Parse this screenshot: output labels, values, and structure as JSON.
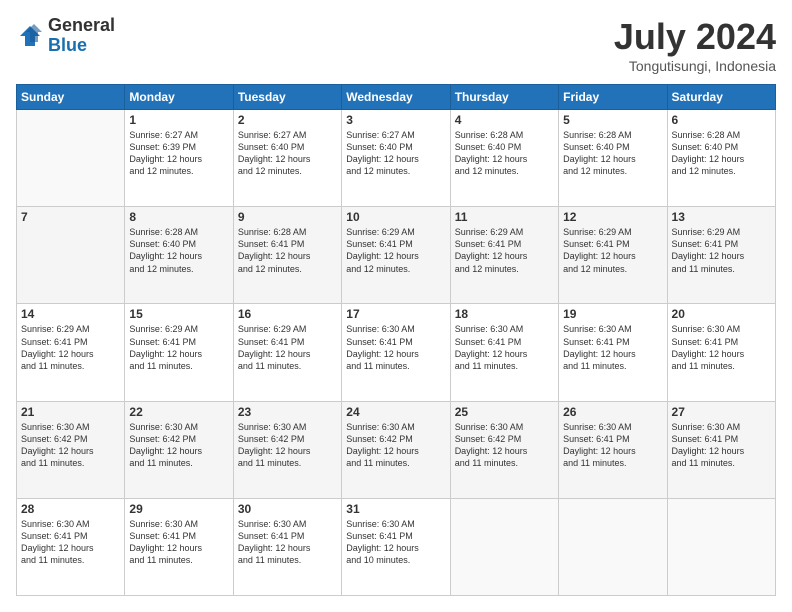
{
  "header": {
    "logo_line1": "General",
    "logo_line2": "Blue",
    "month_title": "July 2024",
    "location": "Tongutisungi, Indonesia"
  },
  "weekdays": [
    "Sunday",
    "Monday",
    "Tuesday",
    "Wednesday",
    "Thursday",
    "Friday",
    "Saturday"
  ],
  "weeks": [
    [
      {
        "day": "",
        "info": ""
      },
      {
        "day": "1",
        "info": "Sunrise: 6:27 AM\nSunset: 6:39 PM\nDaylight: 12 hours\nand 12 minutes."
      },
      {
        "day": "2",
        "info": "Sunrise: 6:27 AM\nSunset: 6:40 PM\nDaylight: 12 hours\nand 12 minutes."
      },
      {
        "day": "3",
        "info": "Sunrise: 6:27 AM\nSunset: 6:40 PM\nDaylight: 12 hours\nand 12 minutes."
      },
      {
        "day": "4",
        "info": "Sunrise: 6:28 AM\nSunset: 6:40 PM\nDaylight: 12 hours\nand 12 minutes."
      },
      {
        "day": "5",
        "info": "Sunrise: 6:28 AM\nSunset: 6:40 PM\nDaylight: 12 hours\nand 12 minutes."
      },
      {
        "day": "6",
        "info": "Sunrise: 6:28 AM\nSunset: 6:40 PM\nDaylight: 12 hours\nand 12 minutes."
      }
    ],
    [
      {
        "day": "7",
        "info": ""
      },
      {
        "day": "8",
        "info": "Sunrise: 6:28 AM\nSunset: 6:40 PM\nDaylight: 12 hours\nand 12 minutes."
      },
      {
        "day": "9",
        "info": "Sunrise: 6:28 AM\nSunset: 6:41 PM\nDaylight: 12 hours\nand 12 minutes."
      },
      {
        "day": "10",
        "info": "Sunrise: 6:29 AM\nSunset: 6:41 PM\nDaylight: 12 hours\nand 12 minutes."
      },
      {
        "day": "11",
        "info": "Sunrise: 6:29 AM\nSunset: 6:41 PM\nDaylight: 12 hours\nand 12 minutes."
      },
      {
        "day": "12",
        "info": "Sunrise: 6:29 AM\nSunset: 6:41 PM\nDaylight: 12 hours\nand 12 minutes."
      },
      {
        "day": "13",
        "info": "Sunrise: 6:29 AM\nSunset: 6:41 PM\nDaylight: 12 hours\nand 11 minutes."
      }
    ],
    [
      {
        "day": "14",
        "info": "Sunrise: 6:29 AM\nSunset: 6:41 PM\nDaylight: 12 hours\nand 11 minutes."
      },
      {
        "day": "15",
        "info": "Sunrise: 6:29 AM\nSunset: 6:41 PM\nDaylight: 12 hours\nand 11 minutes."
      },
      {
        "day": "16",
        "info": "Sunrise: 6:29 AM\nSunset: 6:41 PM\nDaylight: 12 hours\nand 11 minutes."
      },
      {
        "day": "17",
        "info": "Sunrise: 6:30 AM\nSunset: 6:41 PM\nDaylight: 12 hours\nand 11 minutes."
      },
      {
        "day": "18",
        "info": "Sunrise: 6:30 AM\nSunset: 6:41 PM\nDaylight: 12 hours\nand 11 minutes."
      },
      {
        "day": "19",
        "info": "Sunrise: 6:30 AM\nSunset: 6:41 PM\nDaylight: 12 hours\nand 11 minutes."
      },
      {
        "day": "20",
        "info": "Sunrise: 6:30 AM\nSunset: 6:41 PM\nDaylight: 12 hours\nand 11 minutes."
      }
    ],
    [
      {
        "day": "21",
        "info": "Sunrise: 6:30 AM\nSunset: 6:42 PM\nDaylight: 12 hours\nand 11 minutes."
      },
      {
        "day": "22",
        "info": "Sunrise: 6:30 AM\nSunset: 6:42 PM\nDaylight: 12 hours\nand 11 minutes."
      },
      {
        "day": "23",
        "info": "Sunrise: 6:30 AM\nSunset: 6:42 PM\nDaylight: 12 hours\nand 11 minutes."
      },
      {
        "day": "24",
        "info": "Sunrise: 6:30 AM\nSunset: 6:42 PM\nDaylight: 12 hours\nand 11 minutes."
      },
      {
        "day": "25",
        "info": "Sunrise: 6:30 AM\nSunset: 6:42 PM\nDaylight: 12 hours\nand 11 minutes."
      },
      {
        "day": "26",
        "info": "Sunrise: 6:30 AM\nSunset: 6:41 PM\nDaylight: 12 hours\nand 11 minutes."
      },
      {
        "day": "27",
        "info": "Sunrise: 6:30 AM\nSunset: 6:41 PM\nDaylight: 12 hours\nand 11 minutes."
      }
    ],
    [
      {
        "day": "28",
        "info": "Sunrise: 6:30 AM\nSunset: 6:41 PM\nDaylight: 12 hours\nand 11 minutes."
      },
      {
        "day": "29",
        "info": "Sunrise: 6:30 AM\nSunset: 6:41 PM\nDaylight: 12 hours\nand 11 minutes."
      },
      {
        "day": "30",
        "info": "Sunrise: 6:30 AM\nSunset: 6:41 PM\nDaylight: 12 hours\nand 11 minutes."
      },
      {
        "day": "31",
        "info": "Sunrise: 6:30 AM\nSunset: 6:41 PM\nDaylight: 12 hours\nand 10 minutes."
      },
      {
        "day": "",
        "info": ""
      },
      {
        "day": "",
        "info": ""
      },
      {
        "day": "",
        "info": ""
      }
    ]
  ]
}
